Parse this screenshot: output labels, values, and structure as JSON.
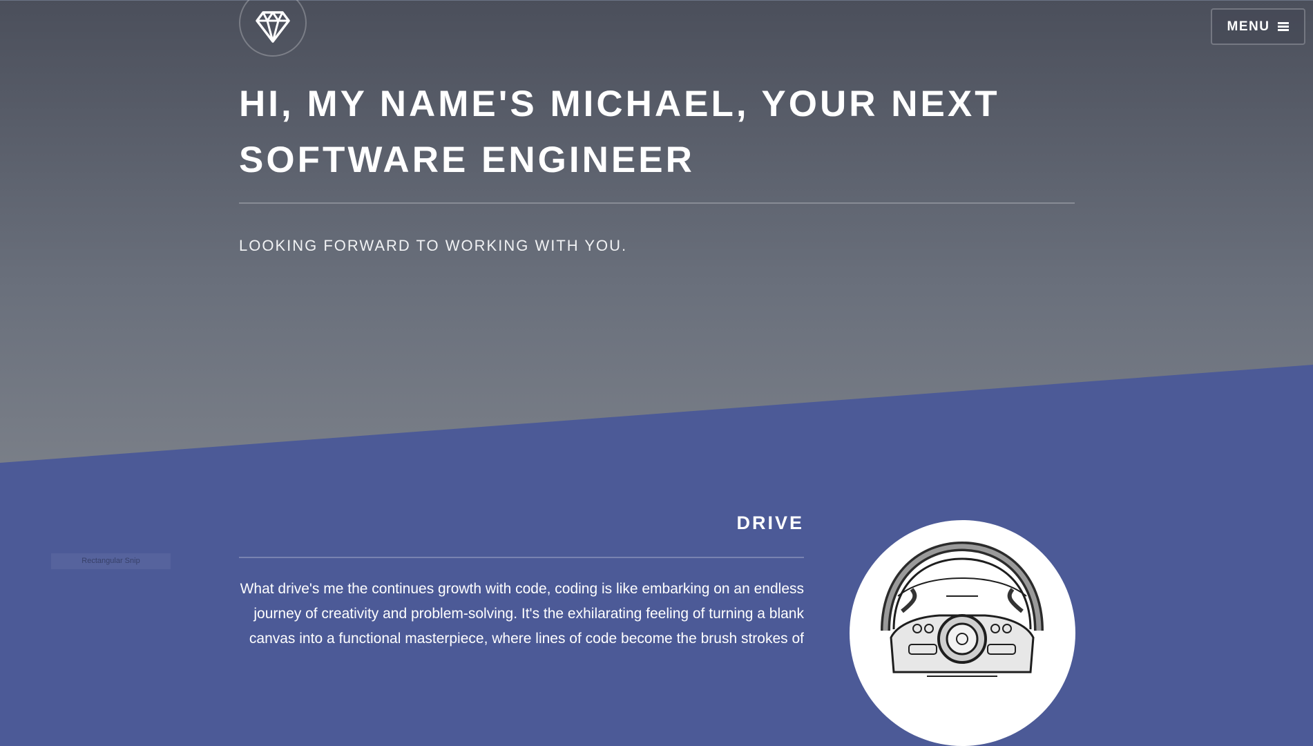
{
  "logo": {
    "icon": "diamond-icon"
  },
  "menu": {
    "label": "MENU",
    "icon": "hamburger-icon"
  },
  "hero": {
    "title": "HI, MY NAME'S MICHAEL, YOUR NEXT SOFTWARE ENGINEER",
    "subtitle": "LOOKING FORWARD TO WORKING WITH YOU."
  },
  "drive": {
    "title": "DRIVE",
    "body": "What drive's me the continues growth with code, coding is like embarking on an endless journey of creativity and problem-solving. It's the exhilarating feeling of turning a blank canvas into a functional masterpiece, where lines of code become the brush strokes of",
    "image": "steering-wheel-illustration"
  },
  "overlay": {
    "snip_label": "Rectangular Snip"
  },
  "colors": {
    "hero_top": "#4b4f5b",
    "hero_bottom": "#7b8089",
    "section_bg": "#4c5a97",
    "text": "#ffffff"
  }
}
